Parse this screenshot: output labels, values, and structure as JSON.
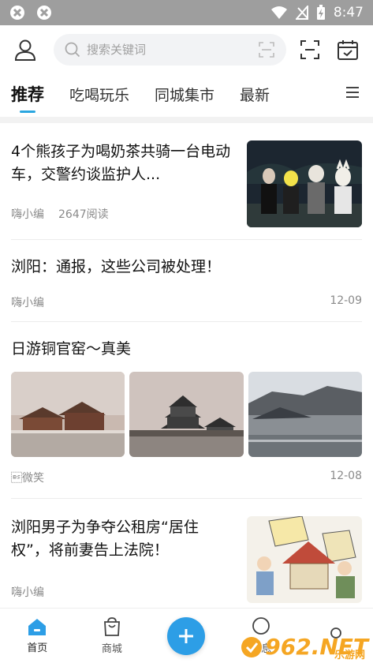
{
  "status_bar": {
    "time": "8:47"
  },
  "search": {
    "placeholder": "搜索关键词"
  },
  "tabs": [
    {
      "label": "推荐",
      "active": true
    },
    {
      "label": "吃喝玩乐",
      "active": false
    },
    {
      "label": "同城集市",
      "active": false
    },
    {
      "label": "最新",
      "active": false
    }
  ],
  "articles": [
    {
      "title": "4个熊孩子为喝奶茶共骑一台电动车，交警约谈监护人...",
      "author": "嗨小编",
      "reads": "2647阅读"
    },
    {
      "title": "浏阳：通报，这些公司被处理！",
      "author": "嗨小编",
      "date": "12-09"
    },
    {
      "title": "日游铜官窑～真美",
      "author": "\b微笑",
      "date": "12-08"
    },
    {
      "title": "浏阳男子为争夺公租房“居住权”，将前妻告上法院！",
      "author": "嗨小编"
    }
  ],
  "bottom_nav": {
    "home": "首页",
    "mall": "商城",
    "messages": "消息"
  },
  "watermark": {
    "brand": "962.NET",
    "sub": "乐游网"
  },
  "colors": {
    "accent": "#2aa6e0",
    "fab": "#2d9ee6",
    "status_bar": "#9e9e9e"
  }
}
